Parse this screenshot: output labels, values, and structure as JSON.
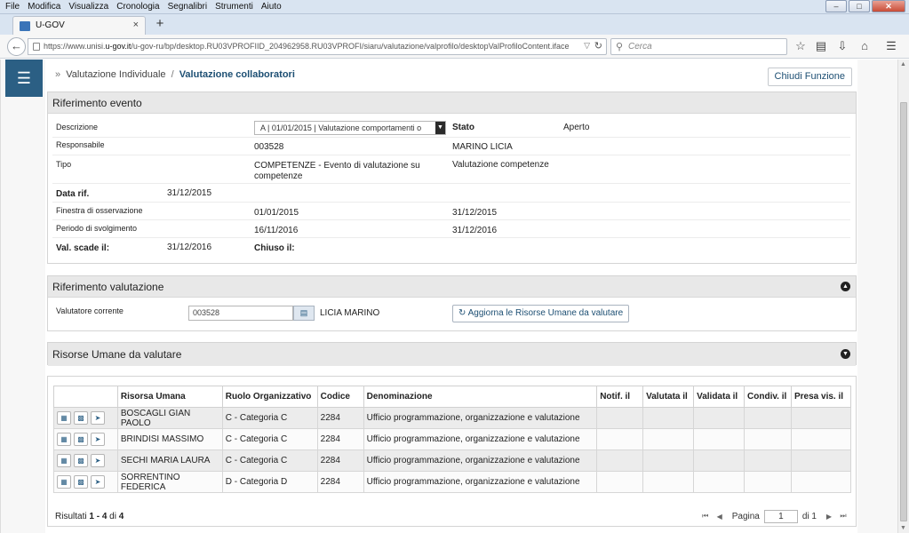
{
  "menubar": {
    "items": [
      "File",
      "Modifica",
      "Visualizza",
      "Cronologia",
      "Segnalibri",
      "Strumenti",
      "Aiuto"
    ]
  },
  "window_controls": {
    "minimize": "–",
    "maximize": "□",
    "close": "✕"
  },
  "tab": {
    "title": "U-GOV",
    "close": "×"
  },
  "newtab": "+",
  "nav": {
    "url_prefix": "https://www.unisi.",
    "url_host": "u-gov.it",
    "url_rest": "/u-gov-ru/bp/desktop.RU03VPROFIID_204962958.RU03VPROFI/siaru/valutazione/valprofilo/desktopValProfiloContent.iface",
    "search_placeholder": "Cerca"
  },
  "icons": {
    "back": "arrow-left-icon",
    "reload": "reload-icon",
    "star": "star-icon",
    "library": "reading-list-icon",
    "download": "download-icon",
    "home": "home-icon",
    "menu": "hamburger-icon"
  },
  "breadcrumb": {
    "parent": "Valutazione Individuale",
    "current": "Valutazione collaboratori"
  },
  "actions": {
    "close_function": "Chiudi Funzione",
    "refresh_resources": "Aggiorna le Risorse Umane da valutare"
  },
  "evento": {
    "title": "Riferimento evento",
    "descrizione_label": "Descrizione",
    "descrizione_value": "A | 01/01/2015 | Valutazione comportamenti o",
    "stato_label": "Stato",
    "stato_value": "Aperto",
    "responsabile_label": "Responsabile",
    "responsabile_code": "003528",
    "responsabile_name": "MARINO LICIA",
    "tipo_label": "Tipo",
    "tipo_value_1": "COMPETENZE - Evento di valutazione su",
    "tipo_value_2": "competenze",
    "tipo_value_right": "Valutazione competenze",
    "data_rif_label": "Data rif.",
    "data_rif_value": "31/12/2015",
    "finestra_label": "Finestra di osservazione",
    "finestra_from": "01/01/2015",
    "finestra_to": "31/12/2015",
    "periodo_label": "Periodo di svolgimento",
    "periodo_from": "16/11/2016",
    "periodo_to": "31/12/2016",
    "scade_label": "Val. scade il:",
    "scade_value": "31/12/2016",
    "chiuso_label": "Chiuso il:"
  },
  "valutazione": {
    "title": "Riferimento valutazione",
    "valutatore_label": "Valutatore corrente",
    "valutatore_code": "003528",
    "valutatore_name": "LICIA MARINO"
  },
  "risorse": {
    "title": "Risorse Umane da valutare"
  },
  "table": {
    "columns": [
      "Risorsa Umana",
      "Ruolo Organizzativo",
      "Codice",
      "Denominazione",
      "Notif. il",
      "Valutata il",
      "Validata il",
      "Condiv. il",
      "Presa vis. il"
    ],
    "rows": [
      {
        "name": "BOSCAGLI GIAN PAOLO",
        "role": "C - Categoria C",
        "code": "2284",
        "denom": "Ufficio programmazione, organizzazione e valutazione"
      },
      {
        "name": "BRINDISI MASSIMO",
        "role": "C - Categoria C",
        "code": "2284",
        "denom": "Ufficio programmazione, organizzazione e valutazione"
      },
      {
        "name": "SECHI MARIA LAURA",
        "role": "C - Categoria C",
        "code": "2284",
        "denom": "Ufficio programmazione, organizzazione e valutazione"
      },
      {
        "name": "SORRENTINO FEDERICA",
        "role": "D - Categoria D",
        "code": "2284",
        "denom": "Ufficio programmazione, organizzazione e valutazione"
      }
    ]
  },
  "pagination": {
    "results_label": "Risultati",
    "from": "1",
    "sep": "-",
    "to": "4",
    "of_label": "di",
    "total": "4",
    "page_label": "Pagina",
    "page": "1",
    "page_of": "di 1"
  },
  "colors": {
    "accent": "#2b5f84",
    "link": "#1d4f73",
    "panel_header": "#e8e8e8",
    "row_alt": "#ececec"
  }
}
